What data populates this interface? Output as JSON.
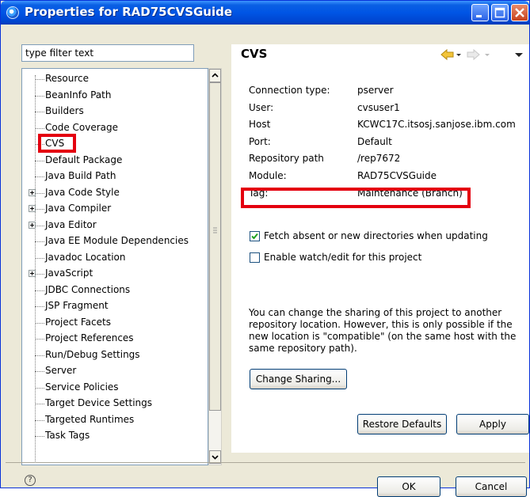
{
  "window": {
    "title": "Properties for RAD75CVSGuide",
    "icon": "properties-icon"
  },
  "filter": {
    "placeholder": "type filter text",
    "value": "type filter text"
  },
  "tree": {
    "items": [
      {
        "label": "Resource",
        "expandable": false
      },
      {
        "label": "BeanInfo Path",
        "expandable": false
      },
      {
        "label": "Builders",
        "expandable": false
      },
      {
        "label": "Code Coverage",
        "expandable": false
      },
      {
        "label": "CVS",
        "expandable": false,
        "selected": true
      },
      {
        "label": "Default Package",
        "expandable": false
      },
      {
        "label": "Java Build Path",
        "expandable": false
      },
      {
        "label": "Java Code Style",
        "expandable": true
      },
      {
        "label": "Java Compiler",
        "expandable": true
      },
      {
        "label": "Java Editor",
        "expandable": true
      },
      {
        "label": "Java EE Module Dependencies",
        "expandable": false
      },
      {
        "label": "Javadoc Location",
        "expandable": false
      },
      {
        "label": "JavaScript",
        "expandable": true
      },
      {
        "label": "JDBC Connections",
        "expandable": false
      },
      {
        "label": "JSP Fragment",
        "expandable": false
      },
      {
        "label": "Project Facets",
        "expandable": false
      },
      {
        "label": "Project References",
        "expandable": false
      },
      {
        "label": "Run/Debug Settings",
        "expandable": false
      },
      {
        "label": "Server",
        "expandable": false
      },
      {
        "label": "Service Policies",
        "expandable": false
      },
      {
        "label": "Target Device Settings",
        "expandable": false
      },
      {
        "label": "Targeted Runtimes",
        "expandable": false
      },
      {
        "label": "Task Tags",
        "expandable": false
      }
    ]
  },
  "page": {
    "title": "CVS",
    "info": [
      {
        "label": "Connection type:",
        "value": "pserver"
      },
      {
        "label": "User:",
        "value": "cvsuser1"
      },
      {
        "label": "Host",
        "value": "KCWC17C.itsosj.sanjose.ibm.com"
      },
      {
        "label": "Port:",
        "value": "Default"
      },
      {
        "label": "Repository path",
        "value": "/rep7672"
      },
      {
        "label": "Module:",
        "value": "RAD75CVSGuide"
      },
      {
        "label": "Tag:",
        "value": "Maintenance (Branch)"
      }
    ],
    "options": [
      {
        "label": "Fetch absent or new directories when updating",
        "checked": true
      },
      {
        "label": "Enable watch/edit for this project",
        "checked": false
      }
    ],
    "description_lines": [
      "You can change the sharing of this project to another",
      "repository location. However, this is only possible if the",
      "new location is \"compatible\" (on the same host with the",
      "same repository path)."
    ],
    "change_sharing_label": "Change Sharing...",
    "restore_defaults_label": "Restore Defaults",
    "apply_label": "Apply"
  },
  "footer": {
    "help_glyph": "?",
    "ok_label": "OK",
    "cancel_label": "Cancel"
  },
  "colors": {
    "title_bar": "#0055e5",
    "highlight": "#e4000f",
    "check_mark": "#21a121"
  }
}
